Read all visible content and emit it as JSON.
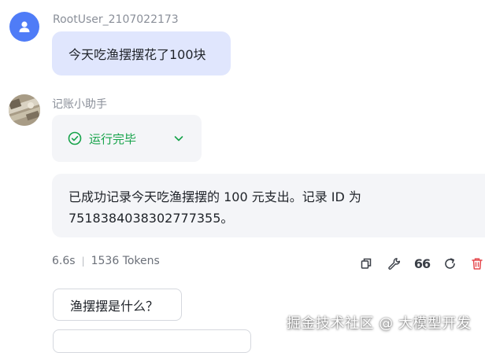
{
  "user_message": {
    "username": "RootUser_2107022173",
    "text": "今天吃渔摆摆花了100块"
  },
  "bot_message": {
    "name": "记账小助手",
    "status": {
      "label": "运行完毕",
      "icon": "check-circle-icon",
      "color": "#16a34a"
    },
    "reply_lines": [
      "已成功记录今天吃渔摆摆的 100 元支出。记录 ID 为",
      "7518384038302777355。"
    ],
    "meta": {
      "duration": "6.6s",
      "tokens": "1536 Tokens"
    },
    "actions": {
      "quote_label": "66"
    }
  },
  "suggestions": [
    "渔摆摆是什么？",
    ""
  ],
  "watermark": "掘金技术社区 @ 大模型开发",
  "colors": {
    "user_bubble": "#e0e6fd",
    "bot_bubble": "#f4f5f8",
    "avatar": "#4f7cf7",
    "delete": "#e5484d"
  }
}
